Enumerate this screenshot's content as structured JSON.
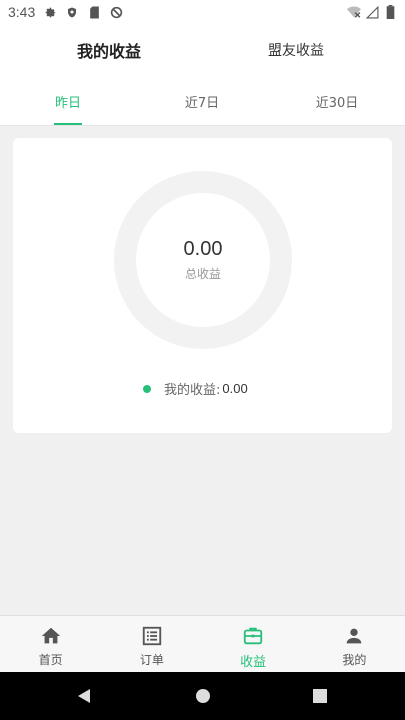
{
  "status": {
    "time": "3:43"
  },
  "header": {
    "main_tab": "我的收益",
    "alt_tab": "盟友收益"
  },
  "subtabs": [
    {
      "label": "昨日",
      "active": true
    },
    {
      "label": "近7日",
      "active": false
    },
    {
      "label": "近30日",
      "active": false
    }
  ],
  "summary": {
    "total_value": "0.00",
    "total_label": "总收益",
    "legend_label": "我的收益:",
    "legend_value": "0.00"
  },
  "colors": {
    "accent": "#27c07a",
    "ring": "#f2f2f2"
  },
  "bottom_nav": [
    {
      "label": "首页",
      "icon": "home-icon",
      "active": false
    },
    {
      "label": "订单",
      "icon": "list-icon",
      "active": false
    },
    {
      "label": "收益",
      "icon": "briefcase-icon",
      "active": true
    },
    {
      "label": "我的",
      "icon": "person-icon",
      "active": false
    }
  ]
}
